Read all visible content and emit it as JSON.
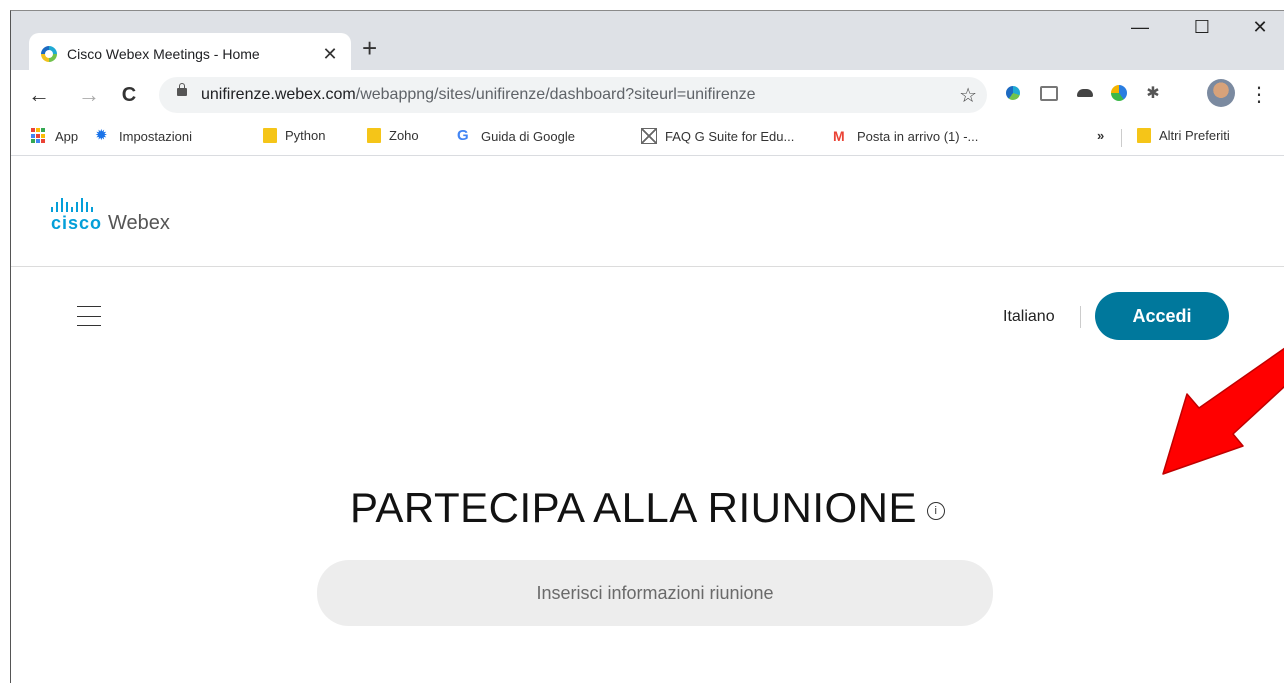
{
  "tab": {
    "title": "Cisco Webex Meetings - Home",
    "close": "✕",
    "new_tab": "+"
  },
  "window_controls": {
    "minimize": "—",
    "maximize": "☐",
    "close": "✕"
  },
  "toolbar": {
    "back": "←",
    "forward": "→",
    "reload": "C",
    "url_domain": "unifirenze.webex.com",
    "url_path": "/webappng/sites/unifirenze/dashboard?siteurl=unifirenze",
    "bookmark_star": "☆",
    "menu": "⋮"
  },
  "bookmarks": {
    "items": [
      {
        "label": "App",
        "icon": "apps-grid-icon"
      },
      {
        "label": "Impostazioni",
        "icon": "gear-icon"
      },
      {
        "label": "Python",
        "icon": "folder-icon"
      },
      {
        "label": "Zoho",
        "icon": "folder-icon"
      },
      {
        "label": "Guida di Google",
        "icon": "google-icon"
      },
      {
        "label": "FAQ G Suite for Edu...",
        "icon": "image-placeholder-icon"
      },
      {
        "label": "Posta in arrivo (1) -...",
        "icon": "gmail-icon"
      }
    ],
    "overflow": "»",
    "other": "Altri Preferiti"
  },
  "page": {
    "logo_cisco": "cisco",
    "logo_webex": "Webex",
    "language": "Italiano",
    "signin": "Accedi",
    "heading": "PARTECIPA ALLA RIUNIONE",
    "info_symbol": "i",
    "join_placeholder": "Inserisci informazioni riunione"
  },
  "colors": {
    "accent": "#00789c",
    "brand": "#049fd9",
    "arrow": "#ff0000"
  }
}
